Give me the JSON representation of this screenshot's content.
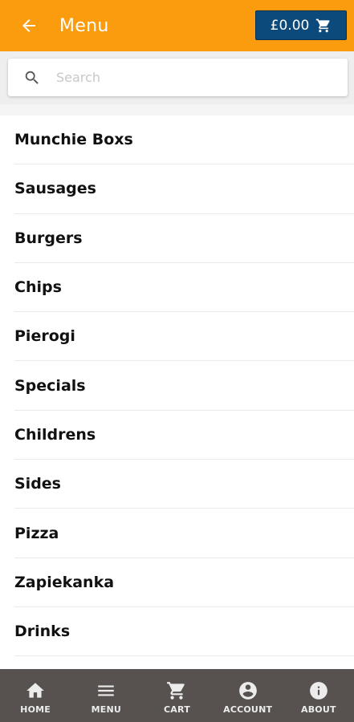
{
  "header": {
    "title": "Menu",
    "back_icon": "arrow-left-icon",
    "cart_total": "£0.00",
    "cart_icon": "cart-icon"
  },
  "search": {
    "placeholder": "Search",
    "value": ""
  },
  "categories": [
    {
      "label": "Munchie Boxs"
    },
    {
      "label": "Sausages"
    },
    {
      "label": "Burgers"
    },
    {
      "label": "Chips"
    },
    {
      "label": "Pierogi"
    },
    {
      "label": "Specials"
    },
    {
      "label": "Childrens"
    },
    {
      "label": "Sides"
    },
    {
      "label": "Pizza"
    },
    {
      "label": "Zapiekanka"
    },
    {
      "label": "Drinks"
    }
  ],
  "bottom_nav": {
    "items": [
      {
        "label": "HOME",
        "icon": "home-icon"
      },
      {
        "label": "MENU",
        "icon": "menu-icon"
      },
      {
        "label": "CART",
        "icon": "cart-icon"
      },
      {
        "label": "ACCOUNT",
        "icon": "account-icon"
      },
      {
        "label": "ABOUT",
        "icon": "info-icon"
      }
    ]
  },
  "colors": {
    "header_bg": "#fb9b0e",
    "cart_button_bg": "#0d4a7c",
    "bottom_nav_bg": "#575250"
  }
}
